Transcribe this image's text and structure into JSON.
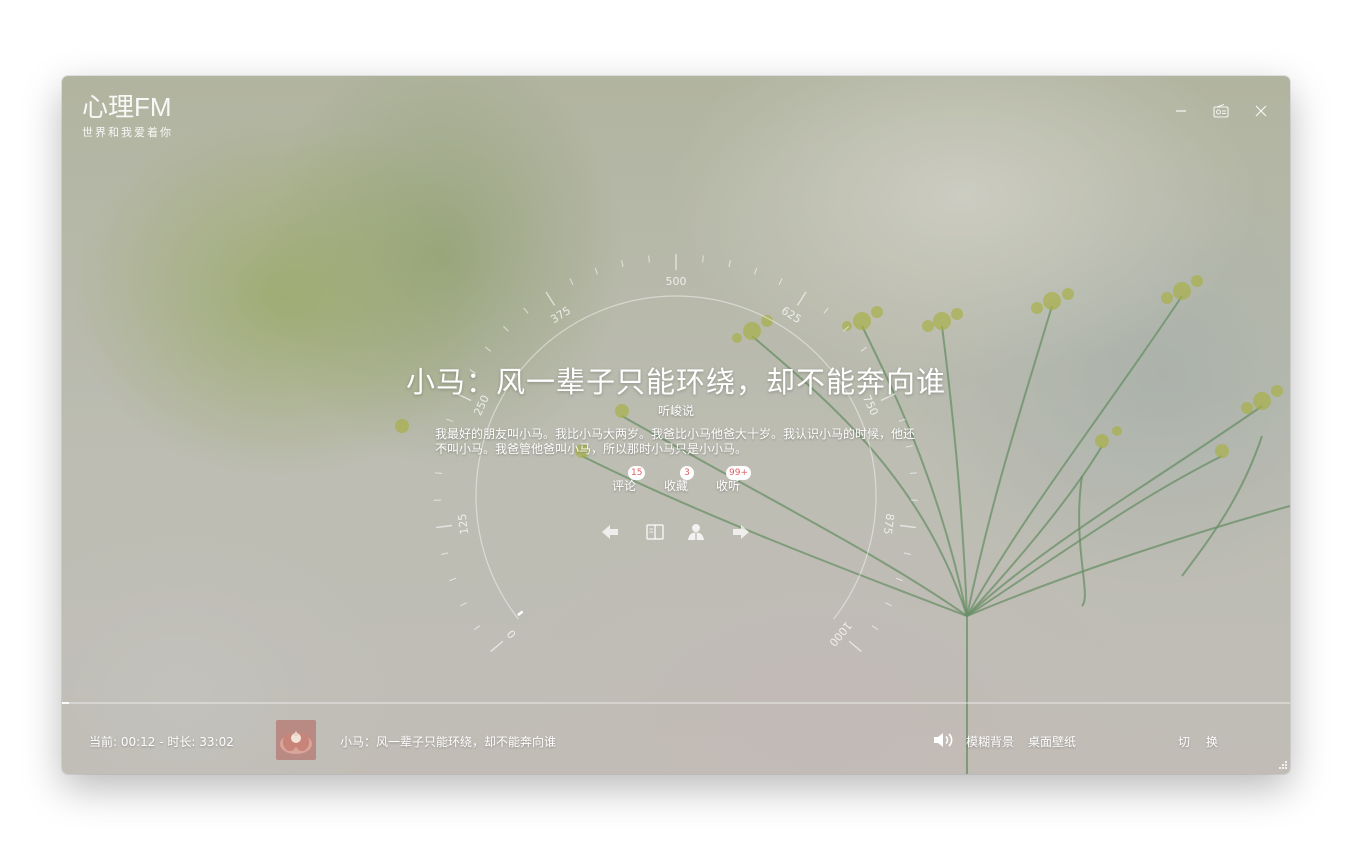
{
  "app": {
    "title": "心理FM",
    "subtitle": "世界和我爱着你"
  },
  "window_controls": {
    "minimize_icon": "minus-icon",
    "radio_icon": "radio-icon",
    "close_icon": "close-icon"
  },
  "dial": {
    "tick_labels": [
      "0",
      "125",
      "250",
      "375",
      "500",
      "625",
      "750",
      "875",
      "1000"
    ]
  },
  "program": {
    "title": "小马：风一辈子只能环绕，却不能奔向谁",
    "author": "听峻说",
    "description": "我最好的朋友叫小马。我比小马大两岁。我爸比小马他爸大十岁。我认识小马的时候，他还不叫小马。我爸管他爸叫小马，所以那时小马只是小小马。"
  },
  "stats": [
    {
      "label": "评论",
      "count": "15"
    },
    {
      "label": "收藏",
      "count": "3"
    },
    {
      "label": "收听",
      "count": "99+"
    }
  ],
  "controls": {
    "prev_icon": "arrow-left-icon",
    "book_icon": "book-icon",
    "anchor_icon": "anchor-person-icon",
    "next_icon": "arrow-right-icon"
  },
  "player": {
    "time_text": "当前: 00:12 - 时长: 33:02",
    "progress": 0.006,
    "now_playing": "小马：风一辈子只能环绕，却不能奔向谁",
    "volume_icon": "volume-icon",
    "blur_bg_label": "模糊背景",
    "wallpaper_label": "桌面壁纸",
    "switch_label": "切 换"
  },
  "colors": {
    "accent": "#ffffff",
    "badge_text": "#e06060"
  }
}
